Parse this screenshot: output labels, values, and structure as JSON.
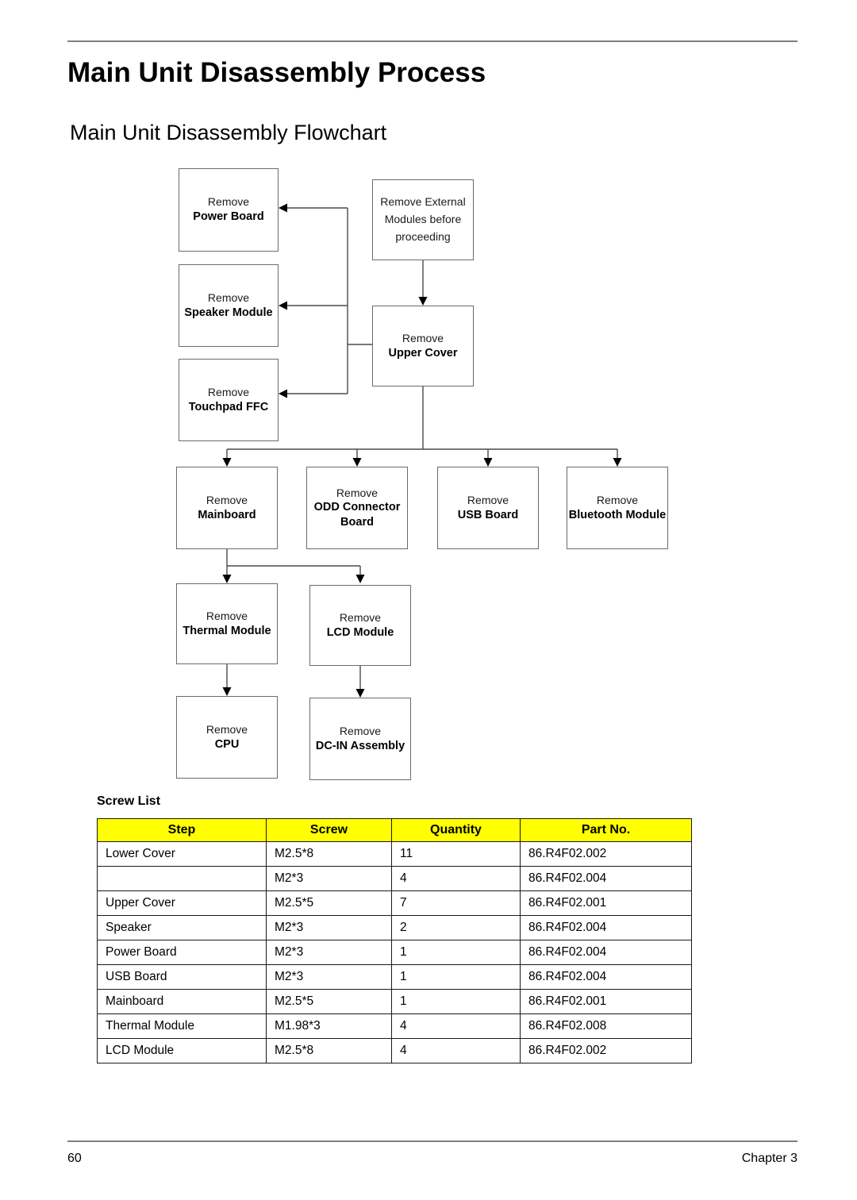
{
  "page": {
    "title": "Main Unit Disassembly Process",
    "section_title": "Main Unit Disassembly Flowchart",
    "footer_page_number": "60",
    "footer_chapter": "Chapter 3"
  },
  "flowchart": {
    "note_box": {
      "line1": "Remove External",
      "line2": "Modules before",
      "line3": "proceeding"
    },
    "boxes": [
      {
        "action": "Remove",
        "target": "Power Board"
      },
      {
        "action": "Remove",
        "target": "Speaker Module"
      },
      {
        "action": "Remove",
        "target": "Touchpad FFC"
      },
      {
        "action": "Remove",
        "target": "Upper Cover"
      },
      {
        "action": "Remove",
        "target": "Mainboard"
      },
      {
        "action": "Remove",
        "target": "ODD Connector"
      },
      {
        "action": "",
        "target": "Board"
      },
      {
        "action": "Remove",
        "target": "USB Board"
      },
      {
        "action": "Remove",
        "target": "Bluetooth Module"
      },
      {
        "action": "Remove",
        "target": "Thermal Module"
      },
      {
        "action": "Remove",
        "target": "LCD Module"
      },
      {
        "action": "Remove",
        "target": "CPU"
      },
      {
        "action": "Remove",
        "target": "DC-IN Assembly"
      }
    ]
  },
  "screw_list": {
    "label": "Screw List",
    "headers": [
      "Step",
      "Screw",
      "Quantity",
      "Part No."
    ],
    "rows": [
      {
        "step": "Lower Cover",
        "screw": "M2.5*8",
        "quantity": "11",
        "part_no": "86.R4F02.002"
      },
      {
        "step": "",
        "screw": "M2*3",
        "quantity": "4",
        "part_no": "86.R4F02.004"
      },
      {
        "step": "Upper Cover",
        "screw": "M2.5*5",
        "quantity": "7",
        "part_no": "86.R4F02.001"
      },
      {
        "step": "Speaker",
        "screw": "M2*3",
        "quantity": "2",
        "part_no": "86.R4F02.004"
      },
      {
        "step": "Power Board",
        "screw": "M2*3",
        "quantity": "1",
        "part_no": "86.R4F02.004"
      },
      {
        "step": "USB Board",
        "screw": "M2*3",
        "quantity": "1",
        "part_no": "86.R4F02.004"
      },
      {
        "step": "Mainboard",
        "screw": "M2.5*5",
        "quantity": "1",
        "part_no": "86.R4F02.001"
      },
      {
        "step": "Thermal Module",
        "screw": "M1.98*3",
        "quantity": "4",
        "part_no": "86.R4F02.008"
      },
      {
        "step": "LCD Module",
        "screw": "M2.5*8",
        "quantity": "4",
        "part_no": "86.R4F02.002"
      }
    ],
    "header_color": "#FFFF00"
  }
}
